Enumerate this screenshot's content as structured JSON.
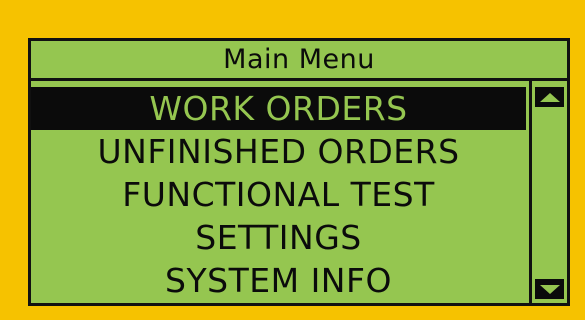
{
  "colors": {
    "bezel": "#f6c200",
    "lcd_background": "#95c650",
    "lcd_foreground": "#0b0b0b"
  },
  "menu": {
    "title": "Main Menu",
    "items": [
      {
        "label": "WORK ORDERS",
        "selected": true
      },
      {
        "label": "UNFINISHED ORDERS",
        "selected": false
      },
      {
        "label": "FUNCTIONAL TEST",
        "selected": false
      },
      {
        "label": "SETTINGS",
        "selected": false
      },
      {
        "label": "SYSTEM INFO",
        "selected": false
      }
    ]
  },
  "scrollbar": {
    "up_icon": "scroll-up-arrow-icon",
    "down_icon": "scroll-down-arrow-icon"
  }
}
